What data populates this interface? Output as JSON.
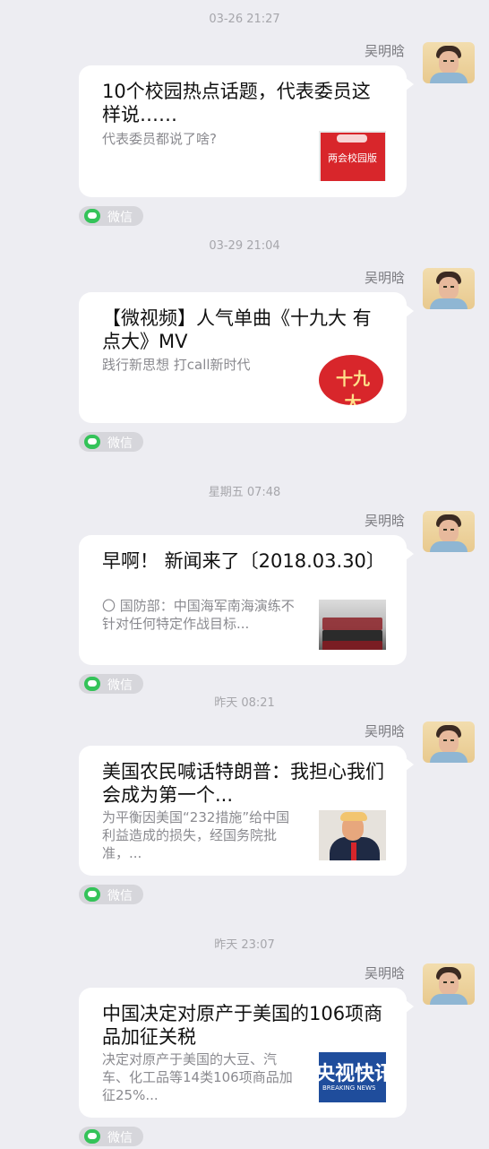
{
  "messages": [
    {
      "timestamp": "03-26 21:27",
      "sender": "吴明晗",
      "title": "10个校园热点话题，代表委员这样说……",
      "description": "代表委员都说了啥?",
      "thumb_text": "两会校园版",
      "source": "微信"
    },
    {
      "timestamp": "03-29 21:04",
      "sender": "吴明晗",
      "title": "【微视频】人气单曲《十九大 有点大》MV",
      "description": "践行新思想 打call新时代",
      "thumb_text": "十九大",
      "source": "微信"
    },
    {
      "timestamp": "星期五 07:48",
      "sender": "吴明晗",
      "title": "早啊！ 新闻来了〔2018.03.30〕",
      "description": "〇 国防部：中国海军南海演练不针对任何特定作战目标...",
      "source": "微信"
    },
    {
      "timestamp": "昨天 08:21",
      "sender": "吴明晗",
      "title": "美国农民喊话特朗普：我担心我们会成为第一个...",
      "description": "为平衡因美国“232措施”给中国利益造成的损失，经国务院批准，...",
      "source": "微信"
    },
    {
      "timestamp": "昨天 23:07",
      "sender": "吴明晗",
      "title": "中国决定对原产于美国的106项商品加征关税",
      "description": "决定对原产于美国的大豆、汽车、化工品等14类106项商品加征25%...",
      "thumb_text": "央视快讯",
      "thumb_subtext": "BREAKING NEWS",
      "source": "微信"
    }
  ]
}
